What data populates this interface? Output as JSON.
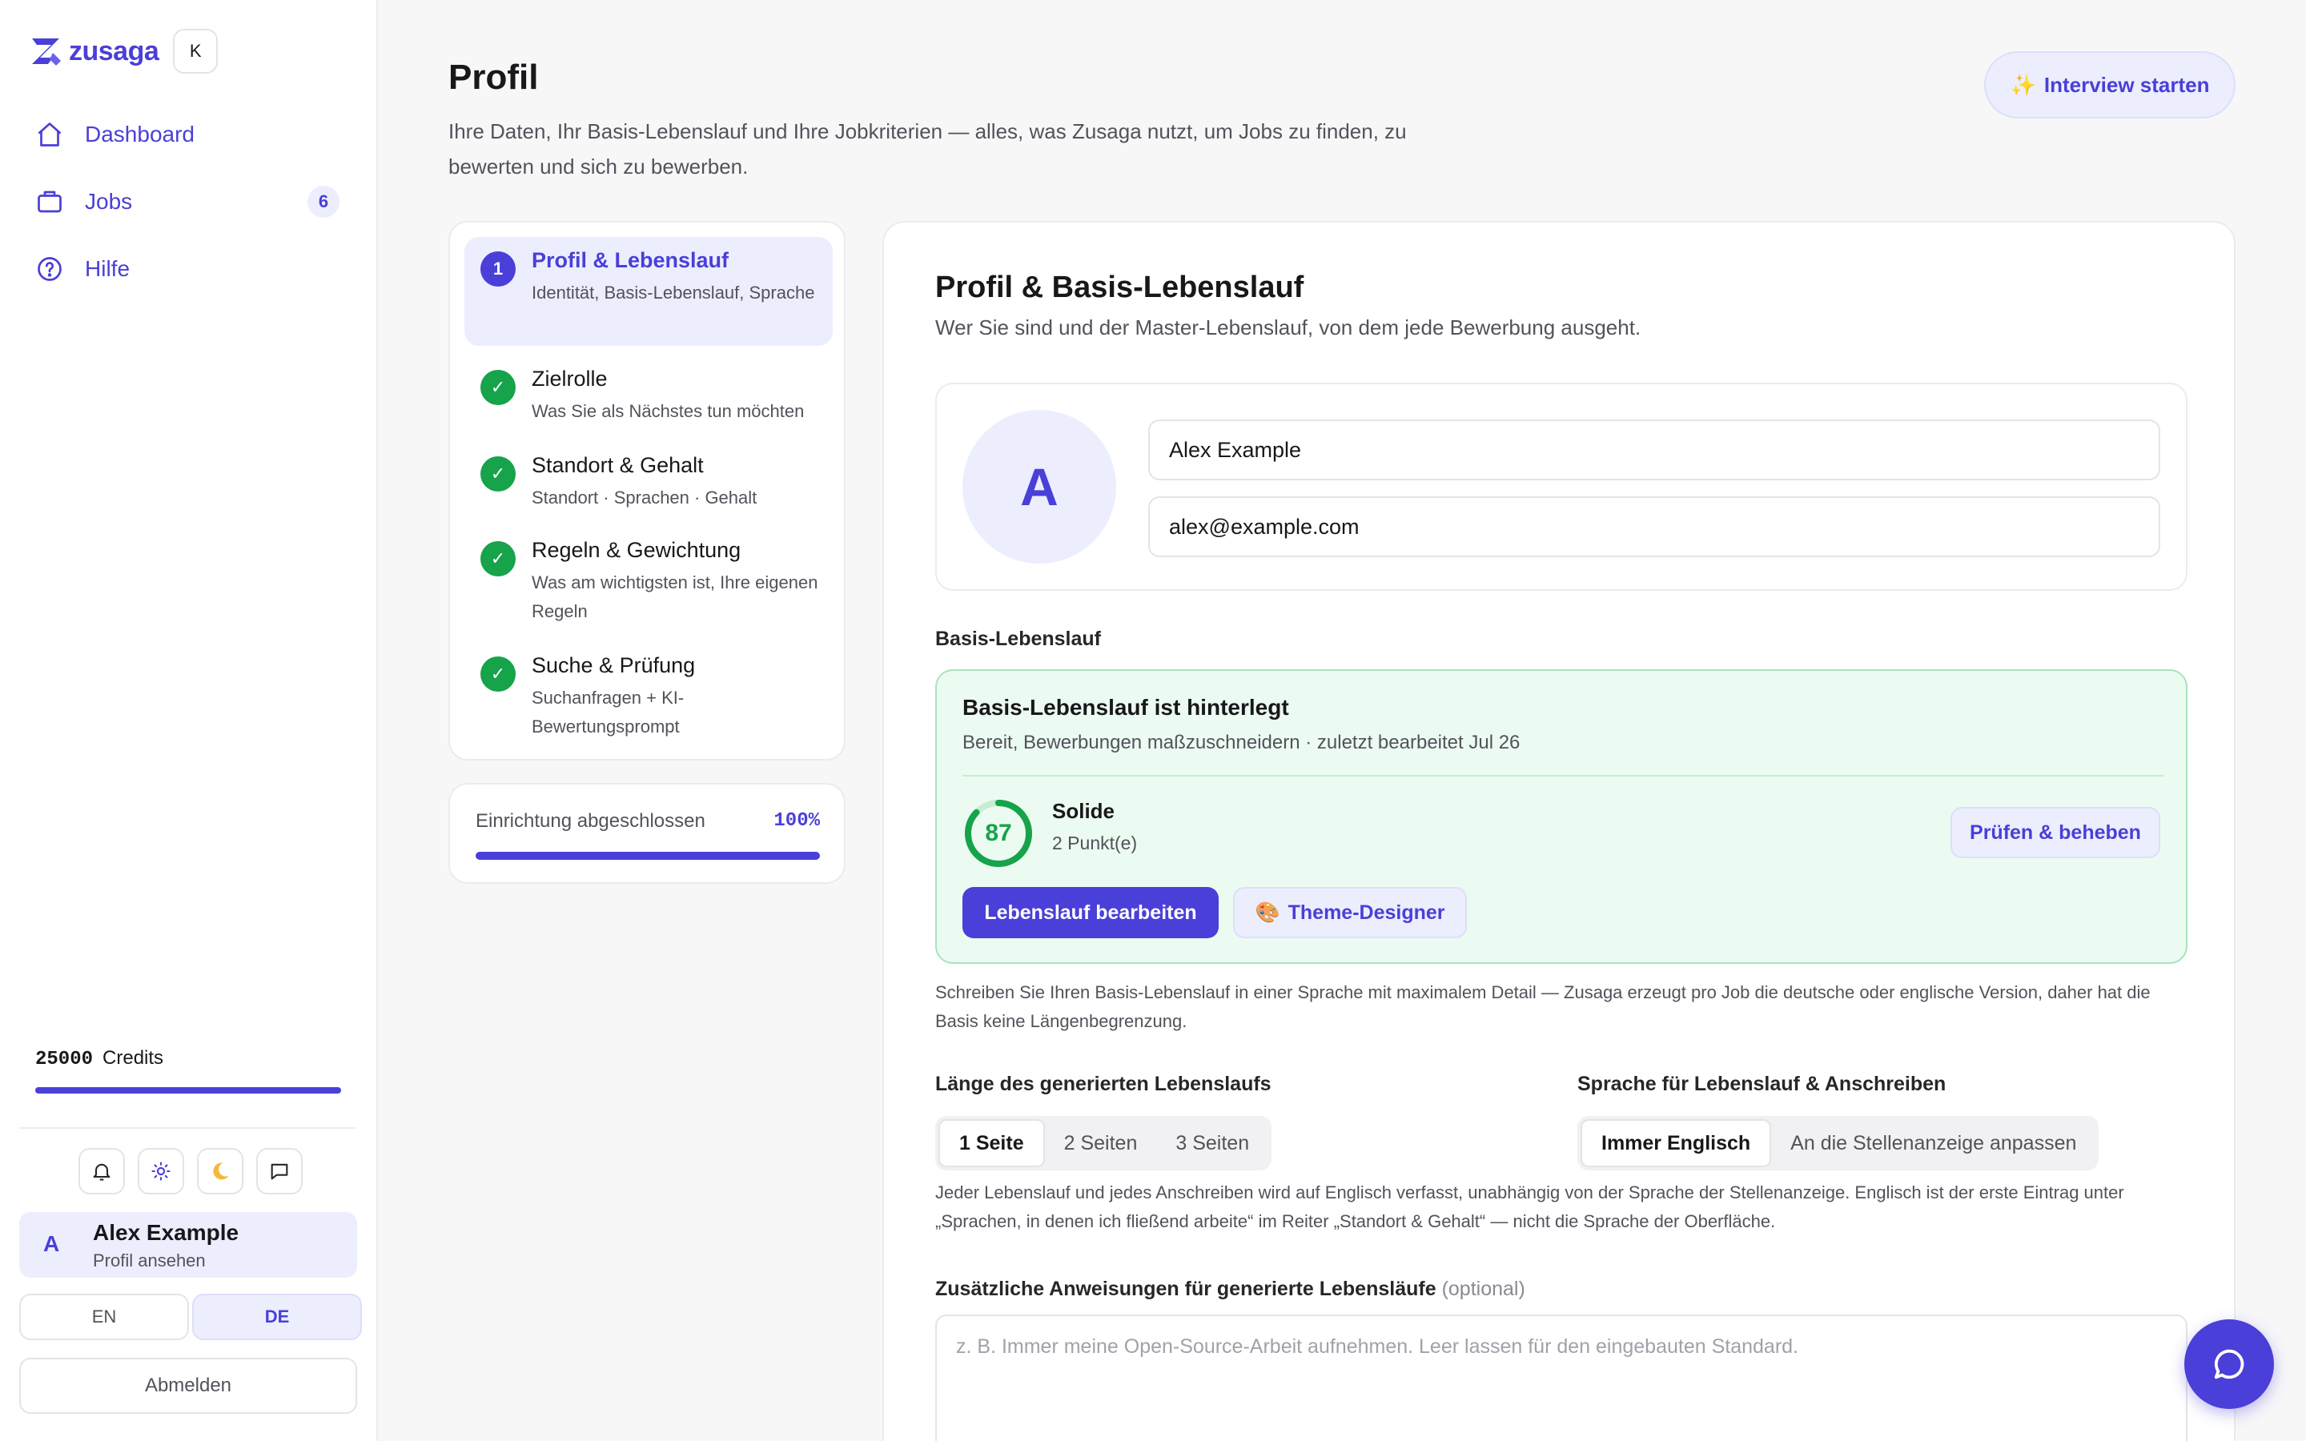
{
  "app": {
    "name": "zusaga",
    "shortcut": "K"
  },
  "colors": {
    "accent": "#4a3fd8",
    "accent_soft": "#eceefd",
    "success": "#16a34a",
    "success_soft": "#ecfbf1"
  },
  "nav": {
    "items": [
      {
        "label": "Dashboard",
        "icon": "home-icon"
      },
      {
        "label": "Jobs",
        "icon": "briefcase-icon",
        "badge": "6"
      },
      {
        "label": "Hilfe",
        "icon": "help-circle-icon"
      }
    ]
  },
  "credits": {
    "amount": "25000",
    "label": "Credits",
    "fill": 1.0
  },
  "toolbar_icons": [
    "bell-icon",
    "sun-icon",
    "moon-icon",
    "chat-icon"
  ],
  "user": {
    "avatar": "A",
    "name": "Alex Example",
    "sub": "Profil ansehen"
  },
  "language": {
    "en": "EN",
    "de": "DE",
    "selected": "DE"
  },
  "logout": "Abmelden",
  "page": {
    "title": "Profil",
    "description": "Ihre Daten, Ihr Basis-Lebenslauf und Ihre Jobkriterien — alles, was Zusaga nutzt, um Jobs zu finden, zu bewerten und sich zu bewerben.",
    "interview_button": "Interview starten"
  },
  "steps": [
    {
      "num": "1",
      "title": "Profil & Lebenslauf",
      "sub": "Identität, Basis-Lebenslauf, Sprache",
      "state": "active"
    },
    {
      "num": "✓",
      "title": "Zielrolle",
      "sub": "Was Sie als Nächstes tun möchten",
      "state": "done"
    },
    {
      "num": "✓",
      "title": "Standort & Gehalt",
      "sub": "Standort · Sprachen · Gehalt",
      "state": "done"
    },
    {
      "num": "✓",
      "title": "Regeln & Gewichtung",
      "sub": "Was am wichtigsten ist, Ihre eigenen Regeln",
      "state": "done"
    },
    {
      "num": "✓",
      "title": "Suche & Prüfung",
      "sub": "Suchanfragen + KI-Bewertungsprompt",
      "state": "done"
    }
  ],
  "setup": {
    "label": "Einrichtung abgeschlossen",
    "percent": "100%",
    "fill": 1.0
  },
  "profile": {
    "title": "Profil & Basis-Lebenslauf",
    "description": "Wer Sie sind und der Master-Lebenslauf, von dem jede Bewerbung ausgeht.",
    "avatar": "A",
    "name_value": "Alex Example",
    "email_value": "alex@example.com"
  },
  "resume": {
    "section_label": "Basis-Lebenslauf",
    "status_title": "Basis-Lebenslauf ist hinterlegt",
    "status_sub": "Bereit, Bewerbungen maßzuschneidern · zuletzt bearbeitet Jul 26",
    "score": "87",
    "score_fraction": 0.87,
    "score_label": "Solide",
    "score_sub": "2 Punkt(e)",
    "fix_button": "Prüfen & beheben",
    "edit_button": "Lebenslauf bearbeiten",
    "theme_button": "Theme-Designer",
    "note": "Schreiben Sie Ihren Basis-Lebenslauf in einer Sprache mit maximalem Detail — Zusaga erzeugt pro Job die deutsche oder englische Version, daher hat die Basis keine Längenbegrenzung."
  },
  "length": {
    "label": "Länge des generierten Lebenslaufs",
    "options": [
      "1 Seite",
      "2 Seiten",
      "3 Seiten"
    ],
    "selected": "1 Seite"
  },
  "output_language": {
    "label": "Sprache für Lebenslauf & Anschreiben",
    "options": [
      "Immer Englisch",
      "An die Stellenanzeige anpassen"
    ],
    "selected": "Immer Englisch",
    "note": "Jeder Lebenslauf und jedes Anschreiben wird auf Englisch verfasst, unabhängig von der Sprache der Stellenanzeige. Englisch ist der erste Eintrag unter „Sprachen, in denen ich fließend arbeite“ im Reiter „Standort & Gehalt“ — nicht die Sprache der Oberfläche."
  },
  "instructions": {
    "label": "Zusätzliche Anweisungen für generierte Lebensläufe",
    "optional": "(optional)",
    "placeholder": "z. B. Immer meine Open-Source-Arbeit aufnehmen. Leer lassen für den eingebauten Standard.",
    "value": ""
  }
}
